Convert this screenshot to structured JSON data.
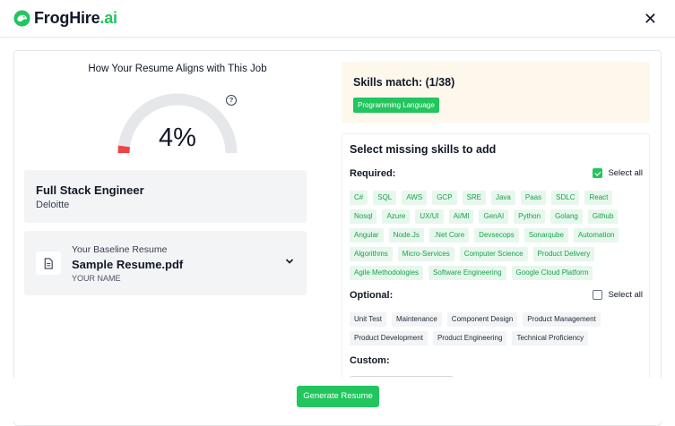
{
  "header": {
    "brand_main": "FrogHire",
    "brand_accent": ".ai",
    "brand_color": "#22c55e",
    "close_icon": "close-icon"
  },
  "alignment": {
    "title": "How Your Resume Aligns with This Job",
    "score_text": "4%",
    "score": 4,
    "help_icon": "question-icon"
  },
  "job": {
    "title": "Full Stack Engineer",
    "company": "Deloitte"
  },
  "resume": {
    "label": "Your Baseline Resume",
    "filename": "Sample Resume.pdf",
    "owner": "YOUR NAME"
  },
  "skills_match": {
    "title": "Skills match: (1/38)",
    "matched": [
      "Programming Language"
    ]
  },
  "missing": {
    "title": "Select missing skills to add",
    "required_label": "Required:",
    "required_select_all": "Select all",
    "required_checked": true,
    "required": [
      "C#",
      "SQL",
      "AWS",
      "GCP",
      "SRE",
      "Java",
      "Paas",
      "SDLC",
      "React",
      "Nosql",
      "Azure",
      "UX/UI",
      "Ai/Ml",
      "GenAI",
      "Python",
      "Golang",
      "Github",
      "Angular",
      "Node.Js",
      ".Net Core",
      "Devsecops",
      "Sonarqube",
      "Automation",
      "Algorithms",
      "Micro-Services",
      "Computer Science",
      "Product Delivery",
      "Agile Methodologies",
      "Software Engineering",
      "Google Cloud Platform"
    ],
    "optional_label": "Optional:",
    "optional_select_all": "Select all",
    "optional_checked": false,
    "optional": [
      "Unit Test",
      "Maintenance",
      "Component Design",
      "Product Management",
      "Product Development",
      "Product Engineering",
      "Technical Proficiency"
    ],
    "custom_label": "Custom:"
  },
  "footer": {
    "generate_label": "Generate Resume"
  }
}
